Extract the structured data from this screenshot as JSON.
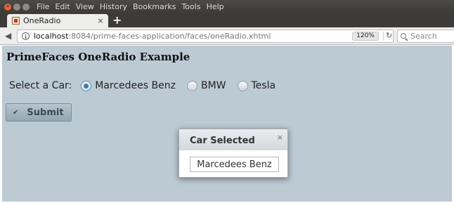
{
  "menubar": {
    "items": [
      "File",
      "Edit",
      "View",
      "History",
      "Bookmarks",
      "Tools",
      "Help"
    ]
  },
  "tab": {
    "title": "OneRadio",
    "close": "×",
    "new_tab": "+"
  },
  "navbar": {
    "url_host": "localhost",
    "url_rest": ":8084/prime-faces-application/faces/oneRadio.xhtml",
    "zoom": "120%",
    "search_placeholder": "Search"
  },
  "page": {
    "title": "PrimeFaces OneRadio Example",
    "select_label": "Select a Car:",
    "options": [
      {
        "label": "Marcedees Benz",
        "checked": true
      },
      {
        "label": "BMW",
        "checked": false
      },
      {
        "label": "Tesla",
        "checked": false
      }
    ],
    "submit_label": "Submit"
  },
  "dialog": {
    "title": "Car Selected",
    "close": "×",
    "value": "Marcedees Benz"
  },
  "colors": {
    "page_bg": "#bccad3",
    "accent": "#3a7db0"
  }
}
